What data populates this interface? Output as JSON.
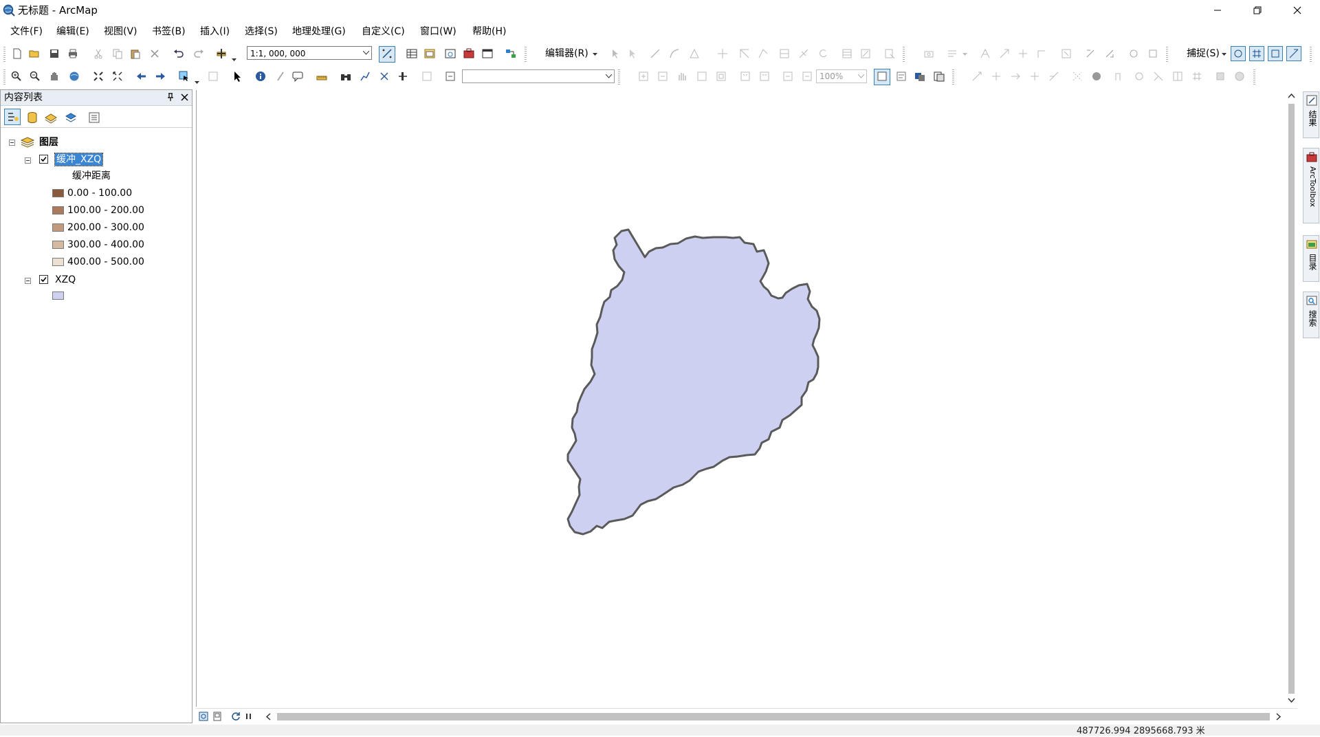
{
  "window": {
    "title": "无标题 - ArcMap",
    "minimize_icon": "minimize-icon",
    "restore_icon": "restore-icon",
    "close_icon": "close-icon"
  },
  "menu": [
    {
      "label": "文件(F)"
    },
    {
      "label": "编辑(E)"
    },
    {
      "label": "视图(V)"
    },
    {
      "label": "书签(B)"
    },
    {
      "label": "插入(I)"
    },
    {
      "label": "选择(S)"
    },
    {
      "label": "地理处理(G)"
    },
    {
      "label": "自定义(C)"
    },
    {
      "label": "窗口(W)"
    },
    {
      "label": "帮助(H)"
    }
  ],
  "toolbar": {
    "scale": "1:1, 000, 000",
    "editor_label": "编辑器(R)",
    "snapping_label": "捕捉(S)",
    "zoom_percent": "100%",
    "layer_combo_value": ""
  },
  "toc": {
    "title": "内容列表",
    "root_label": "图层",
    "layers": [
      {
        "name": "缓冲_XZQ",
        "checked": true,
        "selected": true,
        "field_label": "缓冲距离",
        "classes": [
          {
            "label": "0.00 - 100.00",
            "color": "#8a5a3d"
          },
          {
            "label": "100.00 - 200.00",
            "color": "#a97a5c"
          },
          {
            "label": "200.00 - 300.00",
            "color": "#c19a7e"
          },
          {
            "label": "300.00 - 400.00",
            "color": "#d6b9a1"
          },
          {
            "label": "400.00 - 500.00",
            "color": "#ece0d2"
          }
        ]
      },
      {
        "name": "XZQ",
        "checked": true,
        "selected": false,
        "symbol_color": "#cdd0f0"
      }
    ]
  },
  "map": {
    "polygon_fill": "#cdd0f0",
    "polygon_outline": "#5a5a5a"
  },
  "side_tabs": [
    {
      "label": "结果"
    },
    {
      "label": "ArcToolbox"
    },
    {
      "label": "目录"
    },
    {
      "label": "搜索"
    }
  ],
  "status": {
    "coordinates": "487726.994  2895668.793 米"
  }
}
